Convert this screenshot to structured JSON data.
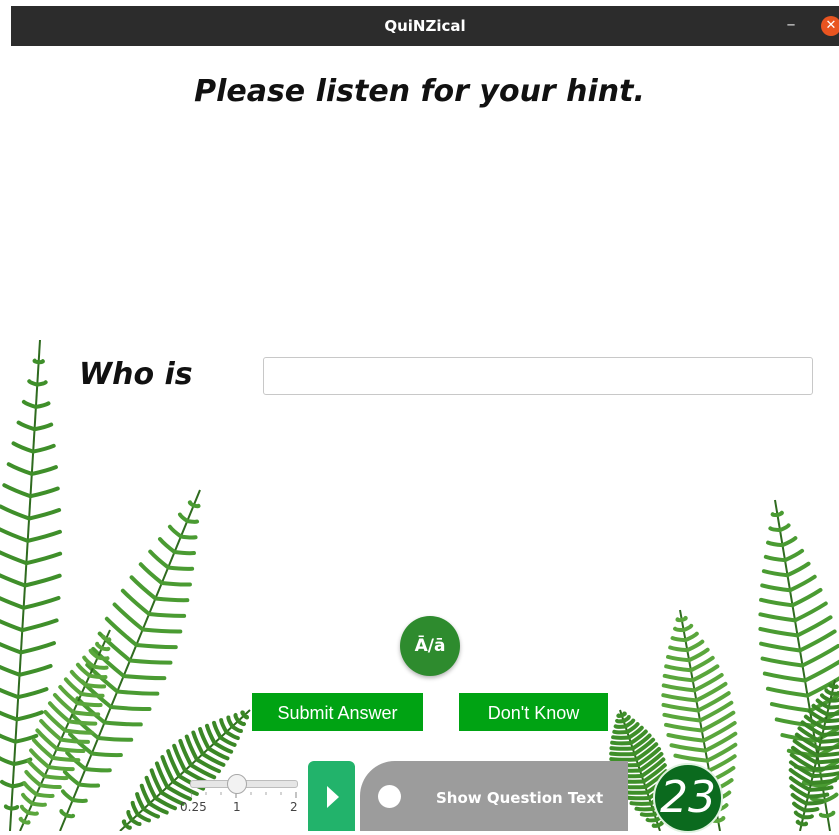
{
  "window": {
    "title": "QuiNZical",
    "minimize_glyph": "–",
    "close_glyph": "✕"
  },
  "main": {
    "heading": "Please listen for your hint.",
    "prompt": "Who is",
    "answer_value": "",
    "macron_label": "Ā/ā",
    "submit_label": "Submit Answer",
    "dont_know_label": "Don't Know"
  },
  "speed": {
    "min_label": "0.25",
    "mid_label": "1",
    "max_label": "2",
    "value": 1
  },
  "toggle": {
    "label": "Show Question Text",
    "on": false
  },
  "timer": {
    "value": "23"
  },
  "colors": {
    "button_green": "#00a313",
    "macron_green": "#2e8b2e",
    "play_green": "#22b36b",
    "toggle_grey": "#9c9c9c",
    "timer_green": "#0b6a1e",
    "close_orange": "#e95420"
  },
  "icons": {
    "play": "play-icon",
    "close": "close-icon",
    "minimize": "minimize-icon",
    "background": "fern-illustration"
  }
}
